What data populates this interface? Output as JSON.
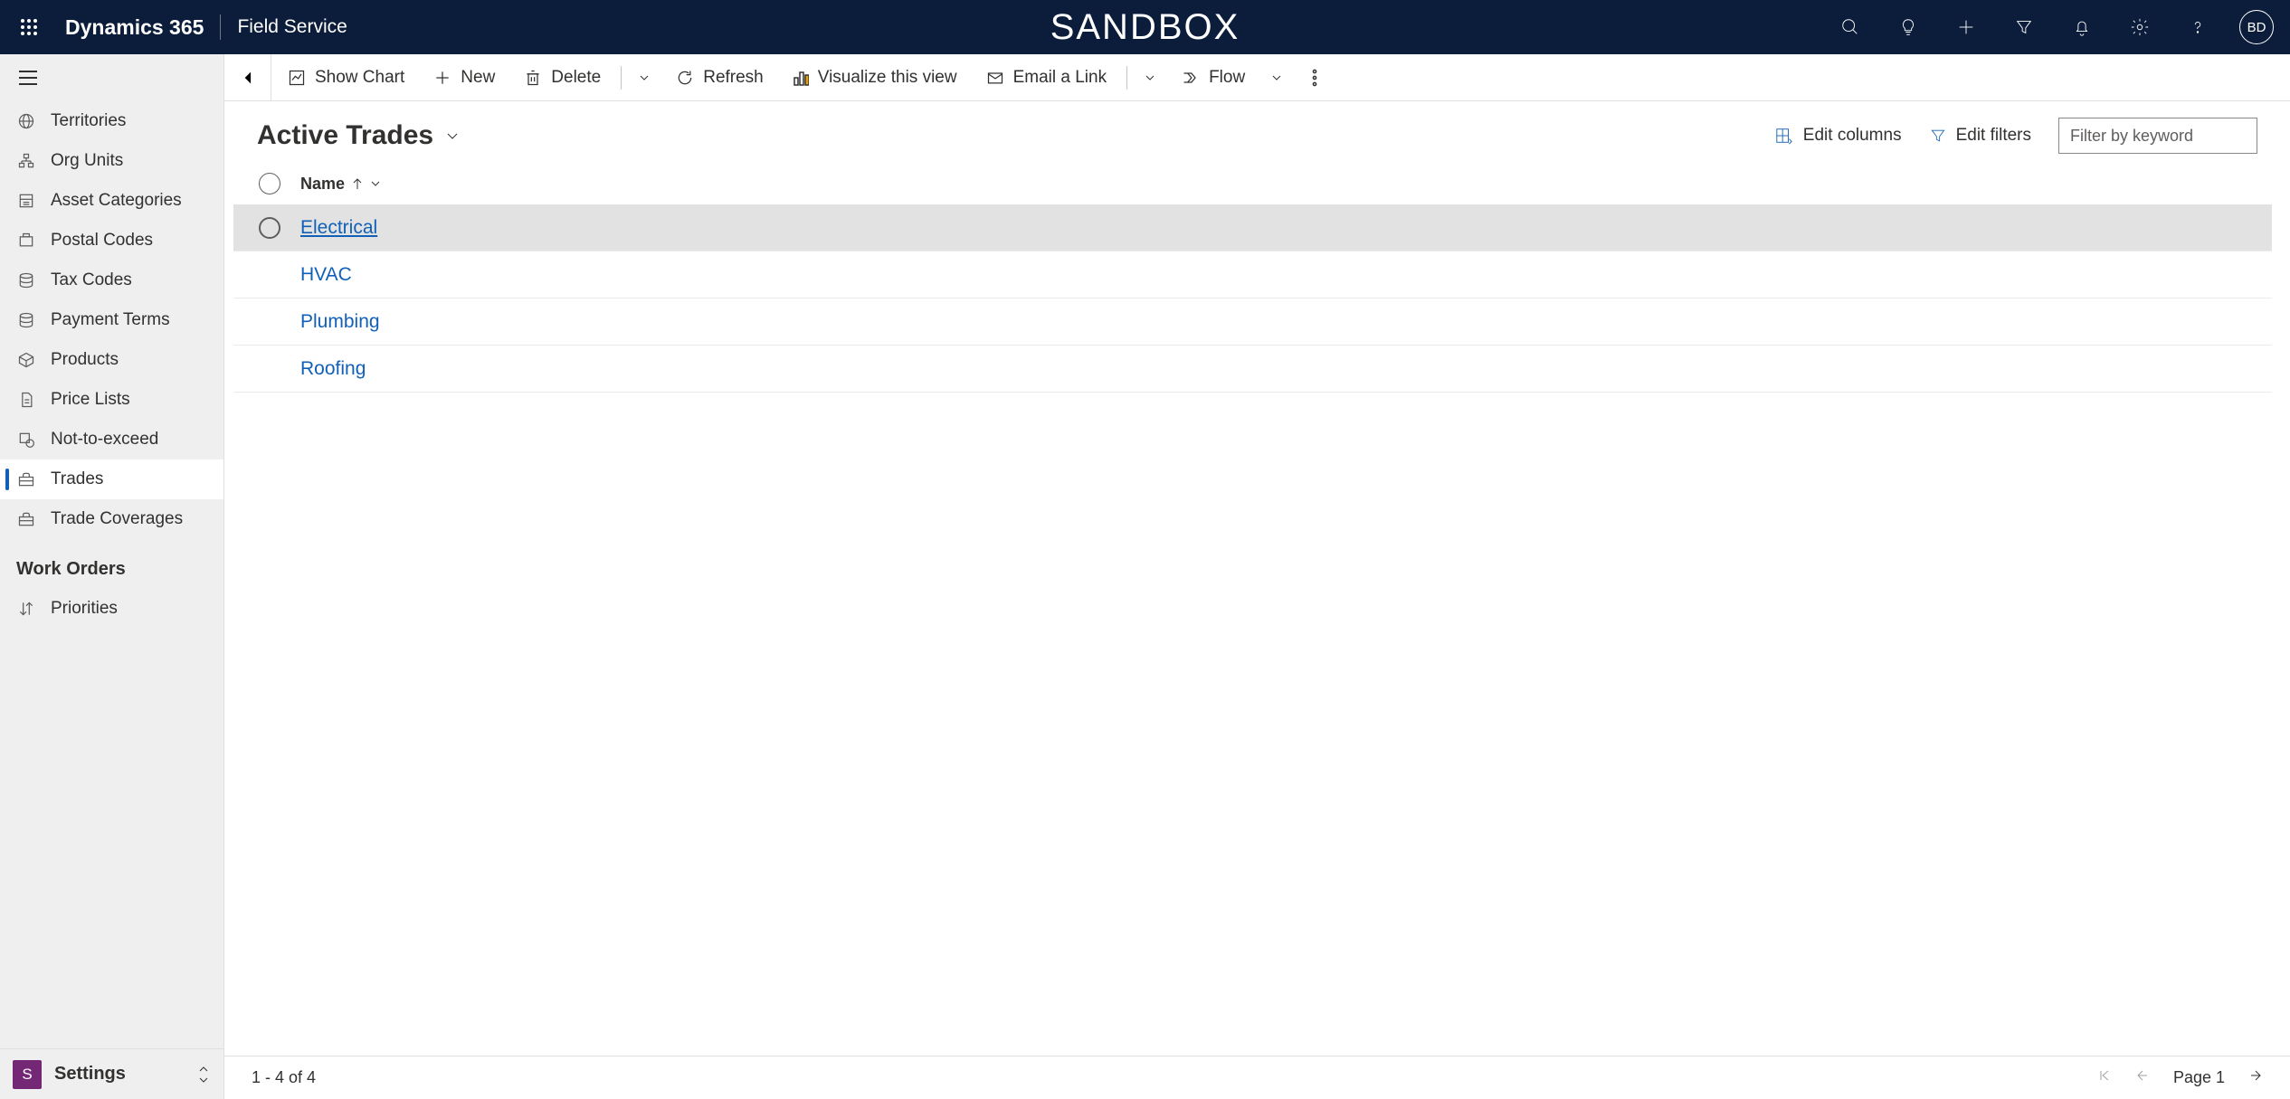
{
  "topbar": {
    "brand": "Dynamics 365",
    "app": "Field Service",
    "env": "SANDBOX",
    "avatar_initials": "BD"
  },
  "sidebar": {
    "items": [
      {
        "icon": "globe",
        "label": "Territories"
      },
      {
        "icon": "org",
        "label": "Org Units"
      },
      {
        "icon": "asset",
        "label": "Asset Categories"
      },
      {
        "icon": "postal",
        "label": "Postal Codes"
      },
      {
        "icon": "stack",
        "label": "Tax Codes"
      },
      {
        "icon": "stack",
        "label": "Payment Terms"
      },
      {
        "icon": "box",
        "label": "Products"
      },
      {
        "icon": "doc",
        "label": "Price Lists"
      },
      {
        "icon": "nte",
        "label": "Not-to-exceed"
      },
      {
        "icon": "toolbox",
        "label": "Trades",
        "active": true
      },
      {
        "icon": "toolbox",
        "label": "Trade Coverages"
      }
    ],
    "group_title": "Work Orders",
    "group_items": [
      {
        "icon": "priority",
        "label": "Priorities"
      }
    ],
    "area": {
      "badge": "S",
      "label": "Settings"
    }
  },
  "cmdbar": {
    "show_chart": "Show Chart",
    "new": "New",
    "delete": "Delete",
    "refresh": "Refresh",
    "visualize": "Visualize this view",
    "email": "Email a Link",
    "flow": "Flow"
  },
  "view": {
    "title": "Active Trades",
    "edit_columns": "Edit columns",
    "edit_filters": "Edit filters",
    "filter_placeholder": "Filter by keyword"
  },
  "grid": {
    "column": "Name",
    "rows": [
      {
        "name": "Electrical",
        "highlight": true
      },
      {
        "name": "HVAC"
      },
      {
        "name": "Plumbing"
      },
      {
        "name": "Roofing"
      }
    ],
    "footer_count": "1 - 4 of 4",
    "page_label": "Page 1"
  }
}
